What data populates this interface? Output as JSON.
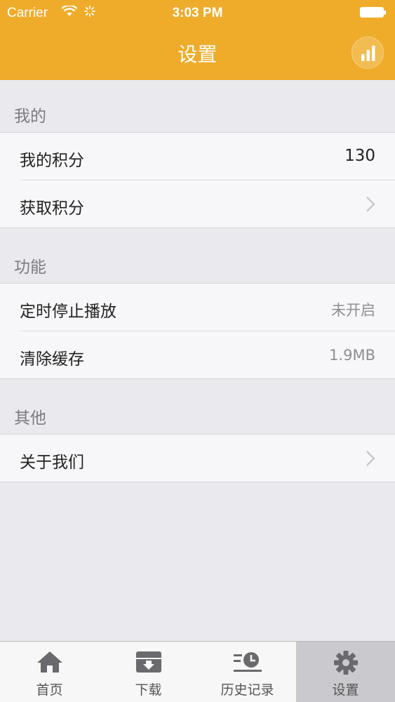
{
  "status": {
    "carrier": "Carrier",
    "time": "3:03 PM"
  },
  "header": {
    "title": "设置"
  },
  "sections": [
    {
      "label": "我的",
      "rows": [
        {
          "label": "我的积分",
          "value": "130"
        },
        {
          "label": "获取积分"
        }
      ]
    },
    {
      "label": "功能",
      "rows": [
        {
          "label": "定时停止播放",
          "value": "未开启"
        },
        {
          "label": "清除缓存",
          "value": "1.9MB"
        }
      ]
    },
    {
      "label": "其他",
      "rows": [
        {
          "label": "关于我们"
        }
      ]
    }
  ],
  "tabs": [
    {
      "label": "首页",
      "icon": "home-icon"
    },
    {
      "label": "下载",
      "icon": "download-box-icon"
    },
    {
      "label": "历史记录",
      "icon": "history-clock-icon"
    },
    {
      "label": "设置",
      "icon": "gear-icon",
      "active": true
    }
  ],
  "colors": {
    "header": "#efac2b",
    "background": "#e9e9ee",
    "activeTab": "#c9c9ce"
  }
}
